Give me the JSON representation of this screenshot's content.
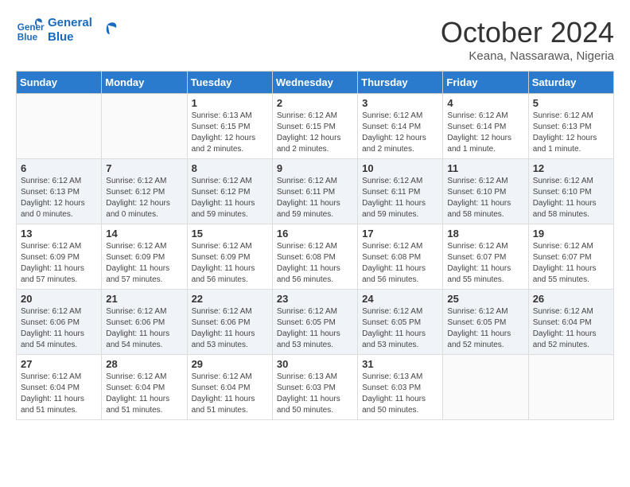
{
  "header": {
    "logo_line1": "General",
    "logo_line2": "Blue",
    "month": "October 2024",
    "location": "Keana, Nassarawa, Nigeria"
  },
  "days_of_week": [
    "Sunday",
    "Monday",
    "Tuesday",
    "Wednesday",
    "Thursday",
    "Friday",
    "Saturday"
  ],
  "weeks": [
    [
      {
        "day": "",
        "info": ""
      },
      {
        "day": "",
        "info": ""
      },
      {
        "day": "1",
        "info": "Sunrise: 6:13 AM\nSunset: 6:15 PM\nDaylight: 12 hours\nand 2 minutes."
      },
      {
        "day": "2",
        "info": "Sunrise: 6:12 AM\nSunset: 6:15 PM\nDaylight: 12 hours\nand 2 minutes."
      },
      {
        "day": "3",
        "info": "Sunrise: 6:12 AM\nSunset: 6:14 PM\nDaylight: 12 hours\nand 2 minutes."
      },
      {
        "day": "4",
        "info": "Sunrise: 6:12 AM\nSunset: 6:14 PM\nDaylight: 12 hours\nand 1 minute."
      },
      {
        "day": "5",
        "info": "Sunrise: 6:12 AM\nSunset: 6:13 PM\nDaylight: 12 hours\nand 1 minute."
      }
    ],
    [
      {
        "day": "6",
        "info": "Sunrise: 6:12 AM\nSunset: 6:13 PM\nDaylight: 12 hours\nand 0 minutes."
      },
      {
        "day": "7",
        "info": "Sunrise: 6:12 AM\nSunset: 6:12 PM\nDaylight: 12 hours\nand 0 minutes."
      },
      {
        "day": "8",
        "info": "Sunrise: 6:12 AM\nSunset: 6:12 PM\nDaylight: 11 hours\nand 59 minutes."
      },
      {
        "day": "9",
        "info": "Sunrise: 6:12 AM\nSunset: 6:11 PM\nDaylight: 11 hours\nand 59 minutes."
      },
      {
        "day": "10",
        "info": "Sunrise: 6:12 AM\nSunset: 6:11 PM\nDaylight: 11 hours\nand 59 minutes."
      },
      {
        "day": "11",
        "info": "Sunrise: 6:12 AM\nSunset: 6:10 PM\nDaylight: 11 hours\nand 58 minutes."
      },
      {
        "day": "12",
        "info": "Sunrise: 6:12 AM\nSunset: 6:10 PM\nDaylight: 11 hours\nand 58 minutes."
      }
    ],
    [
      {
        "day": "13",
        "info": "Sunrise: 6:12 AM\nSunset: 6:09 PM\nDaylight: 11 hours\nand 57 minutes."
      },
      {
        "day": "14",
        "info": "Sunrise: 6:12 AM\nSunset: 6:09 PM\nDaylight: 11 hours\nand 57 minutes."
      },
      {
        "day": "15",
        "info": "Sunrise: 6:12 AM\nSunset: 6:09 PM\nDaylight: 11 hours\nand 56 minutes."
      },
      {
        "day": "16",
        "info": "Sunrise: 6:12 AM\nSunset: 6:08 PM\nDaylight: 11 hours\nand 56 minutes."
      },
      {
        "day": "17",
        "info": "Sunrise: 6:12 AM\nSunset: 6:08 PM\nDaylight: 11 hours\nand 56 minutes."
      },
      {
        "day": "18",
        "info": "Sunrise: 6:12 AM\nSunset: 6:07 PM\nDaylight: 11 hours\nand 55 minutes."
      },
      {
        "day": "19",
        "info": "Sunrise: 6:12 AM\nSunset: 6:07 PM\nDaylight: 11 hours\nand 55 minutes."
      }
    ],
    [
      {
        "day": "20",
        "info": "Sunrise: 6:12 AM\nSunset: 6:06 PM\nDaylight: 11 hours\nand 54 minutes."
      },
      {
        "day": "21",
        "info": "Sunrise: 6:12 AM\nSunset: 6:06 PM\nDaylight: 11 hours\nand 54 minutes."
      },
      {
        "day": "22",
        "info": "Sunrise: 6:12 AM\nSunset: 6:06 PM\nDaylight: 11 hours\nand 53 minutes."
      },
      {
        "day": "23",
        "info": "Sunrise: 6:12 AM\nSunset: 6:05 PM\nDaylight: 11 hours\nand 53 minutes."
      },
      {
        "day": "24",
        "info": "Sunrise: 6:12 AM\nSunset: 6:05 PM\nDaylight: 11 hours\nand 53 minutes."
      },
      {
        "day": "25",
        "info": "Sunrise: 6:12 AM\nSunset: 6:05 PM\nDaylight: 11 hours\nand 52 minutes."
      },
      {
        "day": "26",
        "info": "Sunrise: 6:12 AM\nSunset: 6:04 PM\nDaylight: 11 hours\nand 52 minutes."
      }
    ],
    [
      {
        "day": "27",
        "info": "Sunrise: 6:12 AM\nSunset: 6:04 PM\nDaylight: 11 hours\nand 51 minutes."
      },
      {
        "day": "28",
        "info": "Sunrise: 6:12 AM\nSunset: 6:04 PM\nDaylight: 11 hours\nand 51 minutes."
      },
      {
        "day": "29",
        "info": "Sunrise: 6:12 AM\nSunset: 6:04 PM\nDaylight: 11 hours\nand 51 minutes."
      },
      {
        "day": "30",
        "info": "Sunrise: 6:13 AM\nSunset: 6:03 PM\nDaylight: 11 hours\nand 50 minutes."
      },
      {
        "day": "31",
        "info": "Sunrise: 6:13 AM\nSunset: 6:03 PM\nDaylight: 11 hours\nand 50 minutes."
      },
      {
        "day": "",
        "info": ""
      },
      {
        "day": "",
        "info": ""
      }
    ]
  ]
}
